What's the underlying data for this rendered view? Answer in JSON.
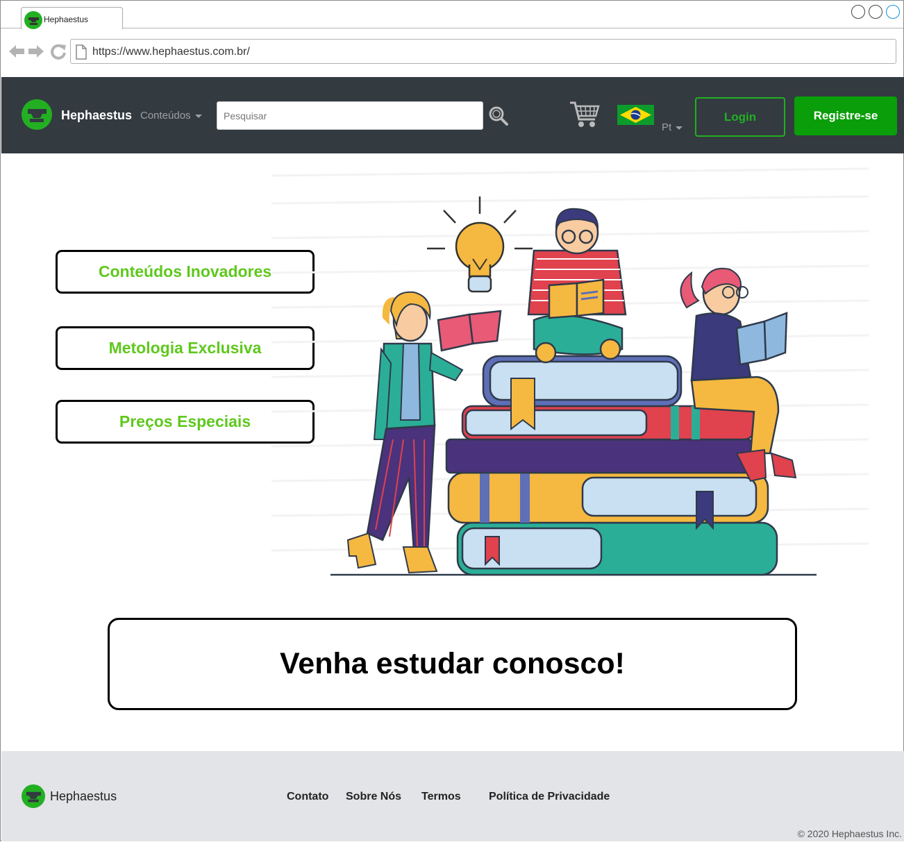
{
  "browser": {
    "tab_title": "Hephaestus",
    "url": "https://www.hephaestus.com.br/"
  },
  "header": {
    "brand": "Hephaestus",
    "menu_label": "Conteúdos",
    "search_placeholder": "Pesquisar",
    "language": "Pt",
    "login_label": "Login",
    "register_label": "Registre-se",
    "icons": [
      "logo-icon",
      "search-icon",
      "cart-icon",
      "brazil-flag-icon"
    ]
  },
  "main": {
    "features": [
      "Conteúdos Inovadores",
      "Metologia Exclusiva",
      "Preços Especiais"
    ],
    "cta": "Venha estudar conosco!"
  },
  "footer": {
    "brand": "Hephaestus",
    "links": [
      "Contato",
      "Sobre Nós",
      "Termos",
      "Política de Privacidade"
    ],
    "copyright": "© 2020 Hephaestus Inc."
  },
  "colors": {
    "header_bg": "#333a40",
    "accent_green": "#0a9e0a",
    "feature_text": "#5fc81e",
    "footer_bg": "#e3e4e7"
  }
}
